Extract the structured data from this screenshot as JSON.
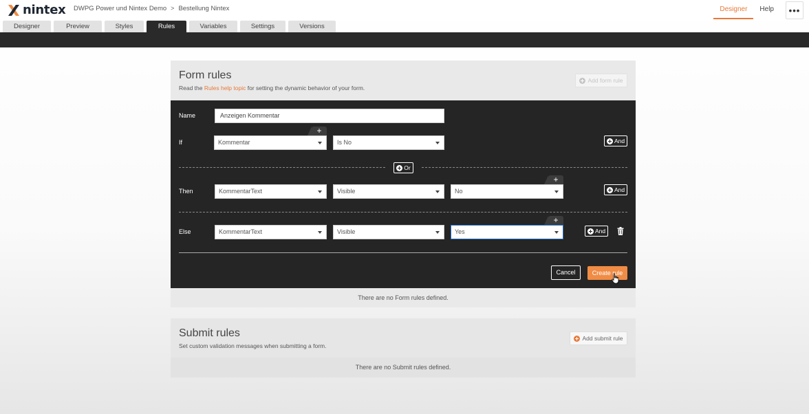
{
  "app": {
    "logo_text": "nintex",
    "breadcrumb": [
      "DWPG Power und Nintex Demo",
      "Bestellung Nintex"
    ],
    "breadcrumb_sep": ">",
    "nav": [
      "Designer",
      "Help"
    ],
    "menu_label": "•••"
  },
  "tabs": [
    {
      "label": "Designer"
    },
    {
      "label": "Preview"
    },
    {
      "label": "Styles"
    },
    {
      "label": "Rules"
    },
    {
      "label": "Variables"
    },
    {
      "label": "Settings"
    },
    {
      "label": "Versions"
    }
  ],
  "form_rules": {
    "title": "Form rules",
    "sub_prefix": "Read the",
    "sub_link": "Rules help topic",
    "sub_suffix": "for setting the dynamic behavior of your form.",
    "add_label": "Add form rule",
    "empty": "There are no Form rules defined."
  },
  "editor": {
    "name_label": "Name",
    "name_value": "Anzeigen Kommentar",
    "if_label": "If",
    "if_field": "Kommentar",
    "if_operator": "Is No",
    "or_label": "Or",
    "then_label": "Then",
    "then_field": "KommentarText",
    "then_action": "Visible",
    "then_value": "No",
    "else_label": "Else",
    "else_field": "KommentarText",
    "else_action": "Visible",
    "else_value": "Yes",
    "and_label": "And",
    "plus": "+",
    "cancel": "Cancel",
    "create": "Create rule"
  },
  "submit_rules": {
    "title": "Submit rules",
    "sub": "Set custom validation messages when submitting a form.",
    "add_label": "Add submit rule",
    "empty": "There are no Submit rules defined."
  },
  "colors": {
    "accent": "#e8793a",
    "dark": "#252525",
    "create_button": "#f08c45"
  }
}
